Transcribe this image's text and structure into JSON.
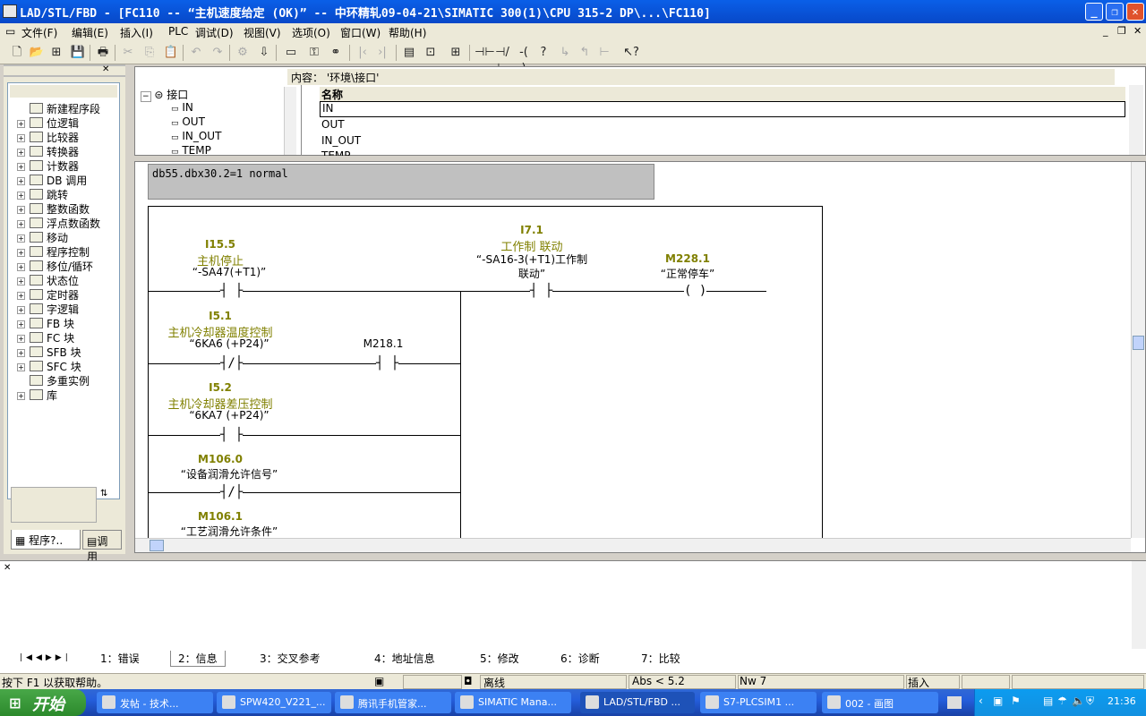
{
  "window": {
    "title": "LAD/STL/FBD  - [FC110 -- “主机速度给定 (OK)” -- 中环精轧09-04-21\\SIMATIC 300(1)\\CPU 315-2 DP\\...\\FC110]",
    "minimize": "_",
    "maximize": "❐",
    "close": "✕"
  },
  "menu": {
    "items": [
      "文件(F)",
      "编辑(E)",
      "插入(I)",
      "PLC",
      "调试(D)",
      "视图(V)",
      "选项(O)",
      "窗口(W)",
      "帮助(H)"
    ]
  },
  "tree": {
    "items": [
      {
        "label": "新建程序段",
        "icon": "NEW",
        "expand": ""
      },
      {
        "label": "位逻辑",
        "icon": "bit",
        "expand": "+"
      },
      {
        "label": "比较器",
        "icon": "cmp",
        "expand": "+"
      },
      {
        "label": "转换器",
        "icon": "cnv",
        "expand": "+"
      },
      {
        "label": "计数器",
        "icon": "cnt",
        "expand": "+"
      },
      {
        "label": "DB 调用",
        "icon": "DB",
        "expand": "+"
      },
      {
        "label": "跳转",
        "icon": "jmp",
        "expand": "+"
      },
      {
        "label": "整数函数",
        "icon": "int",
        "expand": "+"
      },
      {
        "label": "浮点数函数",
        "icon": "flt",
        "expand": "+"
      },
      {
        "label": "移动",
        "icon": "mov",
        "expand": "+"
      },
      {
        "label": "程序控制",
        "icon": "prg",
        "expand": "+"
      },
      {
        "label": "移位/循环",
        "icon": "shf",
        "expand": "+"
      },
      {
        "label": "状态位",
        "icon": "sts",
        "expand": "+"
      },
      {
        "label": "定时器",
        "icon": "tim",
        "expand": "+"
      },
      {
        "label": "字逻辑",
        "icon": "wrd",
        "expand": "+"
      },
      {
        "label": "FB 块",
        "icon": "FB",
        "expand": "+"
      },
      {
        "label": "FC 块",
        "icon": "FC",
        "expand": "+"
      },
      {
        "label": "SFB 块",
        "icon": "SFB",
        "expand": "+"
      },
      {
        "label": "SFC 块",
        "icon": "SFC",
        "expand": "+"
      },
      {
        "label": "多重实例",
        "icon": "multi",
        "expand": ""
      },
      {
        "label": "库",
        "icon": "lib",
        "expand": "+"
      }
    ],
    "tab_program": "程序?..",
    "tab_call": "调用"
  },
  "interface": {
    "content_label": "内容：  '环境\\接口'",
    "root": "接口",
    "left_items": [
      "IN",
      "OUT",
      "IN_OUT",
      "TEMP"
    ],
    "column_name": "名称",
    "right_items": [
      "IN",
      "OUT",
      "IN_OUT",
      "TEMP"
    ]
  },
  "network": {
    "comment": "db55.dbx30.2=1 normal",
    "elements": [
      {
        "addr": "I15.5",
        "sym": "主机停止",
        "cmt": "“-SA47(+T1)”",
        "type": "NO"
      },
      {
        "addr": "I7.1",
        "sym": "工作制 联动",
        "cmt": "“-SA16-3(+T1)工作制",
        "cmt2": "联动”",
        "type": "NO"
      },
      {
        "addr": "M228.1",
        "sym": "",
        "cmt": "“正常停车”",
        "type": "coil"
      },
      {
        "addr": "I5.1",
        "sym": "主机冷却器温度控制",
        "cmt": "“6KA6 (+P24)”",
        "type": "NC"
      },
      {
        "addr": "M218.1",
        "sym": "",
        "cmt": "",
        "type": "NO"
      },
      {
        "addr": "I5.2",
        "sym": "主机冷却器差压控制",
        "cmt": "“6KA7 (+P24)”",
        "type": "NO"
      },
      {
        "addr": "M106.0",
        "sym": "",
        "cmt": "“设备润滑允许信号”",
        "type": "NC"
      },
      {
        "addr": "M106.1",
        "sym": "",
        "cmt": "“工艺润滑允许条件”",
        "type": "NC"
      }
    ]
  },
  "output": {
    "tabs": [
      "1：错误",
      "2：信息",
      "3：交叉参考",
      "4：地址信息",
      "5：修改",
      "6：诊断",
      "7：比较"
    ],
    "active_tab": 1
  },
  "status": {
    "help": "按下 F1 以获取帮助。",
    "mode": "离线",
    "abs": "Abs < 5.2",
    "nw": "Nw 7",
    "insert": "插入"
  },
  "taskbar": {
    "start": "开始",
    "tasks": [
      "发帖 - 技术...",
      "SPW420_V221_...",
      "腾讯手机管家...",
      "SIMATIC Mana...",
      "LAD/STL/FBD ...",
      "S7-PLCSIM1  ...",
      "002 - 画图"
    ],
    "active_task": 4,
    "clock": "21:36"
  },
  "colors": {
    "titlebar": "#0a5fe8",
    "operand": "#808000",
    "taskbar": "#245edb",
    "start": "#3c9a3c"
  }
}
